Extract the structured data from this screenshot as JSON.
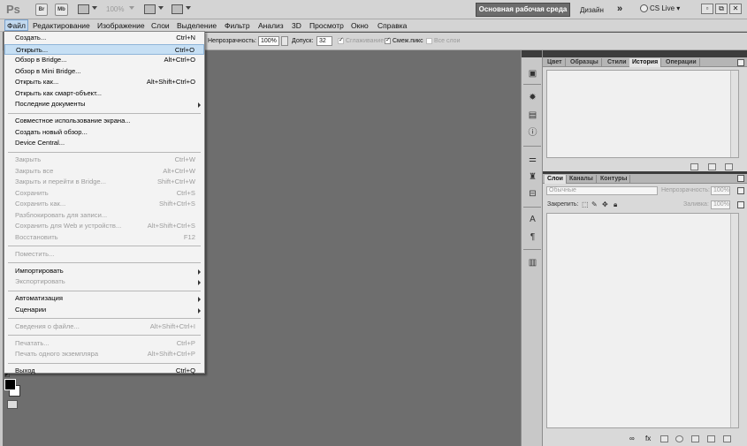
{
  "app": {
    "logo": "Ps",
    "bridge_btn": "Br",
    "minibridge_btn": "Mb",
    "zoom": "100%",
    "workspace_label": "Основная рабочая среда",
    "design_label": "Дизайн",
    "more_label": "»",
    "cs_live": "CS Live",
    "window_buttons": [
      "▫",
      "⧉",
      "✕"
    ]
  },
  "menubar": {
    "items": [
      "Файл",
      "Редактирование",
      "Изображение",
      "Слои",
      "Выделение",
      "Фильтр",
      "Анализ",
      "3D",
      "Просмотр",
      "Окно",
      "Справка"
    ]
  },
  "options": {
    "opacity_label": "Непрозрачность:",
    "opacity_value": "100%",
    "tolerance_label": "Допуск:",
    "tolerance_value": "32",
    "antialias_label": "Сглаживание",
    "contiguous_label": "Смеж.пикс",
    "all_layers_label": "Все слои"
  },
  "file_menu": {
    "groups": [
      [
        {
          "label": "Создать...",
          "shortcut": "Ctrl+N",
          "disabled": false
        },
        {
          "label": "Открыть...",
          "shortcut": "Ctrl+O",
          "disabled": false,
          "highlighted": true
        },
        {
          "label": "Обзор в Bridge...",
          "shortcut": "Alt+Ctrl+O",
          "disabled": false
        },
        {
          "label": "Обзор в Mini Bridge...",
          "shortcut": "",
          "disabled": false
        },
        {
          "label": "Открыть как...",
          "shortcut": "Alt+Shift+Ctrl+O",
          "disabled": false
        },
        {
          "label": "Открыть как смарт-объект...",
          "shortcut": "",
          "disabled": false
        },
        {
          "label": "Последние документы",
          "shortcut": "",
          "disabled": false,
          "submenu": true
        }
      ],
      [
        {
          "label": "Совместное использование экрана...",
          "shortcut": "",
          "disabled": false
        },
        {
          "label": "Создать новый обзор...",
          "shortcut": "",
          "disabled": false
        },
        {
          "label": "Device Central...",
          "shortcut": "",
          "disabled": false
        }
      ],
      [
        {
          "label": "Закрыть",
          "shortcut": "Ctrl+W",
          "disabled": true
        },
        {
          "label": "Закрыть все",
          "shortcut": "Alt+Ctrl+W",
          "disabled": true
        },
        {
          "label": "Закрыть и перейти в Bridge...",
          "shortcut": "Shift+Ctrl+W",
          "disabled": true
        },
        {
          "label": "Сохранить",
          "shortcut": "Ctrl+S",
          "disabled": true
        },
        {
          "label": "Сохранить как...",
          "shortcut": "Shift+Ctrl+S",
          "disabled": true
        },
        {
          "label": "Разблокировать для записи...",
          "shortcut": "",
          "disabled": true
        },
        {
          "label": "Сохранить для Web и устройств...",
          "shortcut": "Alt+Shift+Ctrl+S",
          "disabled": true
        },
        {
          "label": "Восстановить",
          "shortcut": "F12",
          "disabled": true
        }
      ],
      [
        {
          "label": "Поместить...",
          "shortcut": "",
          "disabled": true
        }
      ],
      [
        {
          "label": "Импортировать",
          "shortcut": "",
          "disabled": false,
          "submenu": true
        },
        {
          "label": "Экспортировать",
          "shortcut": "",
          "disabled": true,
          "submenu": true
        }
      ],
      [
        {
          "label": "Автоматизация",
          "shortcut": "",
          "disabled": false,
          "submenu": true
        },
        {
          "label": "Сценарии",
          "shortcut": "",
          "disabled": false,
          "submenu": true
        }
      ],
      [
        {
          "label": "Сведения о файле...",
          "shortcut": "Alt+Shift+Ctrl+I",
          "disabled": true
        }
      ],
      [
        {
          "label": "Печатать...",
          "shortcut": "Ctrl+P",
          "disabled": true
        },
        {
          "label": "Печать одного экземпляра",
          "shortcut": "Alt+Shift+Ctrl+P",
          "disabled": true
        }
      ],
      [
        {
          "label": "Выход",
          "shortcut": "Ctrl+Q",
          "disabled": false
        }
      ]
    ]
  },
  "top_panel": {
    "tabs": [
      "Цвет",
      "Образцы",
      "Стили",
      "История",
      "Операции"
    ],
    "active_tab": "История"
  },
  "layers_panel": {
    "tabs": [
      "Слои",
      "Каналы",
      "Контуры"
    ],
    "active_tab": "Слои",
    "blend_mode": "Обычные",
    "opacity_label": "Непрозрачность:",
    "opacity_value": "100%",
    "lock_label": "Закрепить:",
    "fill_label": "Заливка:",
    "fill_value": "100%"
  },
  "dock_icons": [
    "mini-bridge-icon",
    "navigator-icon",
    "histogram-icon",
    "info-icon",
    "brushes-icon",
    "clone-source-icon",
    "tool-presets-icon",
    "character-icon",
    "paragraph-icon",
    "notes-icon"
  ]
}
